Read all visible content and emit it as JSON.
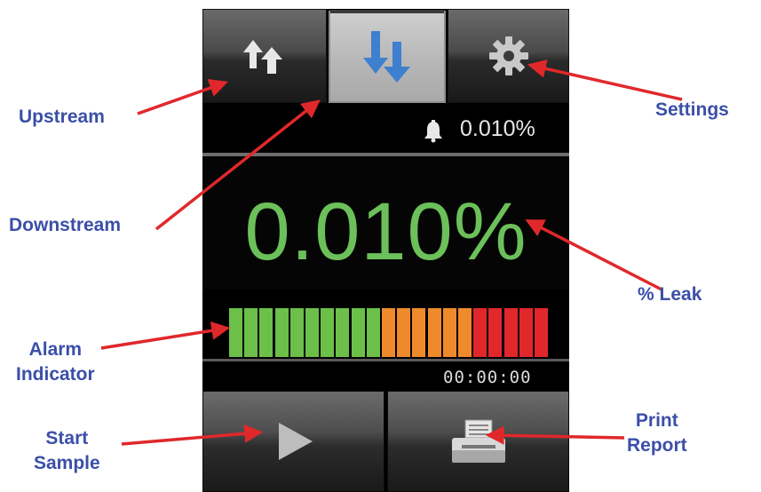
{
  "device": {
    "tabs": [
      {
        "id": "upstream",
        "icon": "upstream-arrows-icon"
      },
      {
        "id": "downstream",
        "icon": "downstream-arrows-icon",
        "selected": true
      },
      {
        "id": "settings",
        "icon": "gear-icon"
      }
    ],
    "alarm": {
      "icon": "bell-icon",
      "value": "0.010%"
    },
    "leak_value": "0.010%",
    "alarm_indicator": {
      "segments": 21,
      "colors": {
        "green": "#6cc04a",
        "orange": "#ef8a2c",
        "red": "#e0282b"
      },
      "green_count": 10,
      "orange_count": 6,
      "red_count": 5
    },
    "timer": "00:00:00",
    "buttons": {
      "start": {
        "icon": "play-icon"
      },
      "print": {
        "icon": "printer-icon"
      }
    }
  },
  "callouts": {
    "upstream": "Upstream",
    "downstream": "Downstream",
    "settings": "Settings",
    "leak": "% Leak",
    "alarm_indicator_line1": "Alarm",
    "alarm_indicator_line2": "Indicator",
    "start_line1": "Start",
    "start_line2": "Sample",
    "print_line1": "Print",
    "print_line2": "Report"
  },
  "colors": {
    "callout_text": "#3b4fa8",
    "arrow": "#e0282b",
    "leak_text": "#6cc05a"
  }
}
